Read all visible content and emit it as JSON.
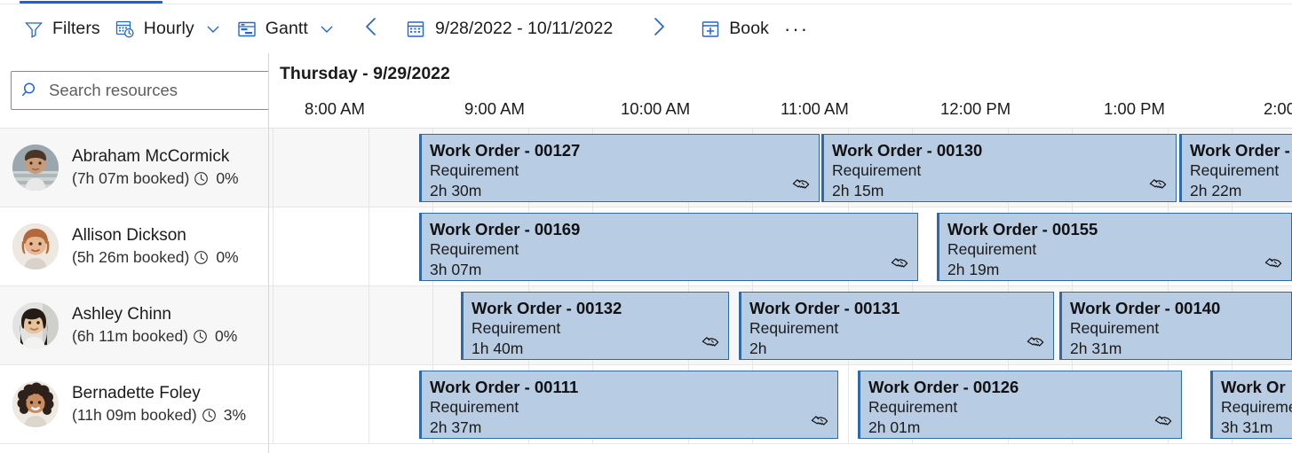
{
  "toolbar": {
    "filters_label": "Filters",
    "filters_icon": "filter-icon",
    "hourly_label": "Hourly",
    "hourly_icon": "calendar-clock-icon",
    "gantt_label": "Gantt",
    "gantt_icon": "gantt-icon",
    "prev_icon": "chevron-left-icon",
    "next_icon": "chevron-right-icon",
    "date_icon": "calendar-icon",
    "date_range": "9/28/2022 - 10/11/2022",
    "book_label": "Book",
    "book_icon": "calendar-add-icon",
    "overflow_label": "···",
    "accent_color": "#1b63d4"
  },
  "search": {
    "placeholder": "Search resources",
    "value": "",
    "icon": "search-icon",
    "sort_icon": "sort-arrows-icon"
  },
  "resources": [
    {
      "name": "Abraham McCormick",
      "booked": "(7h 07m booked)",
      "clock_icon": "clock-icon",
      "percent": "0%"
    },
    {
      "name": "Allison Dickson",
      "booked": "(5h 26m booked)",
      "clock_icon": "clock-icon",
      "percent": "0%"
    },
    {
      "name": "Ashley Chinn",
      "booked": "(6h 11m booked)",
      "clock_icon": "clock-icon",
      "percent": "0%"
    },
    {
      "name": "Bernadette Foley",
      "booked": "(11h 09m booked)",
      "clock_icon": "clock-icon",
      "percent": "3%"
    }
  ],
  "schedule": {
    "day_header": "Thursday - 9/29/2022",
    "hours": [
      "8:00 AM",
      "9:00 AM",
      "10:00 AM",
      "11:00 AM",
      "12:00 PM",
      "1:00 PM",
      "2:00"
    ],
    "booking_color": "#b8cce4",
    "booking_border": "#2e6aa8",
    "rows": [
      {
        "resource": "Abraham McCormick",
        "bookings": [
          {
            "title": "Work Order - 00127",
            "subtitle": "Requirement",
            "duration": "2h 30m",
            "icon": "handshake-icon",
            "show_icon": true
          },
          {
            "title": "Work Order - 00130",
            "subtitle": "Requirement",
            "duration": "2h 15m",
            "icon": "handshake-icon",
            "show_icon": true
          },
          {
            "title": "Work Order -",
            "subtitle": "Requirement",
            "duration": "2h 22m",
            "icon": "handshake-icon",
            "show_icon": false
          }
        ]
      },
      {
        "resource": "Allison Dickson",
        "bookings": [
          {
            "title": "Work Order - 00169",
            "subtitle": "Requirement",
            "duration": "3h 07m",
            "icon": "handshake-icon",
            "show_icon": true
          },
          {
            "title": "Work Order - 00155",
            "subtitle": "Requirement",
            "duration": "2h 19m",
            "icon": "handshake-icon",
            "show_icon": true
          }
        ]
      },
      {
        "resource": "Ashley Chinn",
        "bookings": [
          {
            "title": "Work Order - 00132",
            "subtitle": "Requirement",
            "duration": "1h 40m",
            "icon": "handshake-icon",
            "show_icon": true
          },
          {
            "title": "Work Order - 00131",
            "subtitle": "Requirement",
            "duration": "2h",
            "icon": "handshake-icon",
            "show_icon": true
          },
          {
            "title": "Work Order - 00140",
            "subtitle": "Requirement",
            "duration": "2h 31m",
            "icon": "handshake-icon",
            "show_icon": false
          }
        ]
      },
      {
        "resource": "Bernadette Foley",
        "bookings": [
          {
            "title": "Work Order - 00111",
            "subtitle": "Requirement",
            "duration": "2h 37m",
            "icon": "handshake-icon",
            "show_icon": true
          },
          {
            "title": "Work Order - 00126",
            "subtitle": "Requirement",
            "duration": "2h 01m",
            "icon": "handshake-icon",
            "show_icon": true
          },
          {
            "title": "Work Or",
            "subtitle": "Requiremen",
            "duration": "3h 31m",
            "icon": "handshake-icon",
            "show_icon": false
          }
        ]
      }
    ]
  }
}
